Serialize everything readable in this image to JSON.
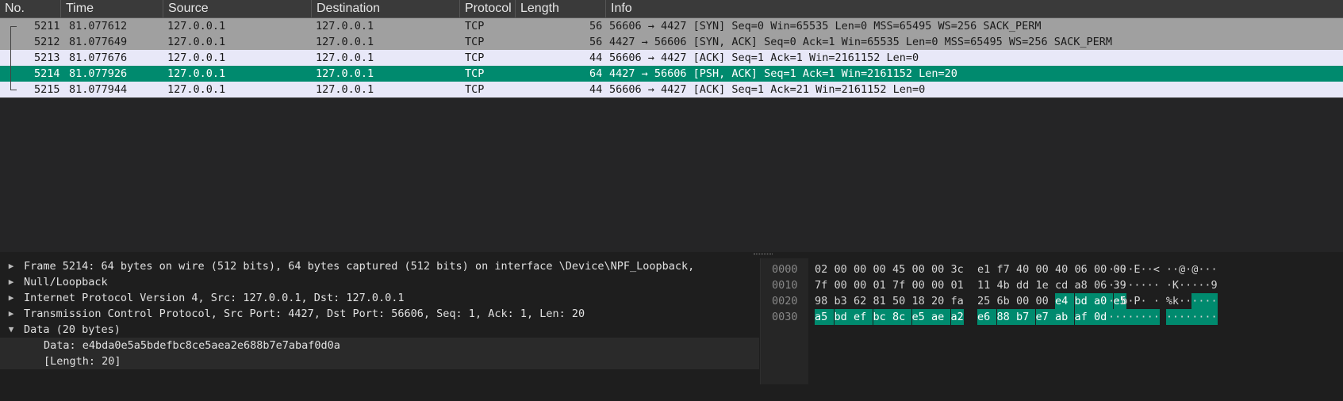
{
  "columns": [
    "No.",
    "Time",
    "Source",
    "Destination",
    "Protocol",
    "Length",
    "Info"
  ],
  "packets": [
    {
      "no": "5211",
      "time": "81.077612",
      "source": "127.0.0.1",
      "destination": "127.0.0.1",
      "protocol": "TCP",
      "length": "56",
      "info": "56606 → 4427 [SYN] Seq=0 Win=65535 Len=0 MSS=65495 WS=256 SACK_PERM"
    },
    {
      "no": "5212",
      "time": "81.077649",
      "source": "127.0.0.1",
      "destination": "127.0.0.1",
      "protocol": "TCP",
      "length": "56",
      "info": "4427 → 56606 [SYN, ACK] Seq=0 Ack=1 Win=65535 Len=0 MSS=65495 WS=256 SACK_PERM"
    },
    {
      "no": "5213",
      "time": "81.077676",
      "source": "127.0.0.1",
      "destination": "127.0.0.1",
      "protocol": "TCP",
      "length": "44",
      "info": "56606 → 4427 [ACK] Seq=1 Ack=1 Win=2161152 Len=0"
    },
    {
      "no": "5214",
      "time": "81.077926",
      "source": "127.0.0.1",
      "destination": "127.0.0.1",
      "protocol": "TCP",
      "length": "64",
      "info": "4427 → 56606 [PSH, ACK] Seq=1 Ack=1 Win=2161152 Len=20"
    },
    {
      "no": "5215",
      "time": "81.077944",
      "source": "127.0.0.1",
      "destination": "127.0.0.1",
      "protocol": "TCP",
      "length": "44",
      "info": "56606 → 4427 [ACK] Seq=1 Ack=21 Win=2161152 Len=0"
    }
  ],
  "details": [
    {
      "icon": "expand-right-icon",
      "text": "Frame 5214: 64 bytes on wire (512 bits), 64 bytes captured (512 bits) on interface \\Device\\NPF_Loopback,"
    },
    {
      "icon": "expand-right-icon",
      "text": "Null/Loopback"
    },
    {
      "icon": "expand-right-icon",
      "text": "Internet Protocol Version 4, Src: 127.0.0.1, Dst: 127.0.0.1"
    },
    {
      "icon": "expand-right-icon",
      "text": "Transmission Control Protocol, Src Port: 4427, Dst Port: 56606, Seq: 1, Ack: 1, Len: 20"
    },
    {
      "icon": "collapse-down-icon",
      "text": "Data (20 bytes)"
    },
    {
      "text": "Data: e4bda0e5a5bdefbc8ce5aea2e688b7e7abaf0d0a"
    },
    {
      "text": "[Length: 20]"
    }
  ],
  "hex_rows": [
    {
      "offset": "0000",
      "bytes": [
        "02",
        "00",
        "00",
        "00",
        "45",
        "00",
        "00",
        "3c",
        "e1",
        "f7",
        "40",
        "00",
        "40",
        "06",
        "00",
        "00"
      ],
      "ascii": "····E··<··@·@···"
    },
    {
      "offset": "0010",
      "bytes": [
        "7f",
        "00",
        "00",
        "01",
        "7f",
        "00",
        "00",
        "01",
        "11",
        "4b",
        "dd",
        "1e",
        "cd",
        "a8",
        "06",
        "39"
      ],
      "ascii": "·········K·····9"
    },
    {
      "offset": "0020",
      "bytes": [
        "98",
        "b3",
        "62",
        "81",
        "50",
        "18",
        "20",
        "fa",
        "25",
        "6b",
        "00",
        "00",
        "e4",
        "bd",
        "a0",
        "e5"
      ],
      "ascii": "··b·P· ·%k······"
    },
    {
      "offset": "0030",
      "bytes": [
        "a5",
        "bd",
        "ef",
        "bc",
        "8c",
        "e5",
        "ae",
        "a2",
        "e6",
        "88",
        "b7",
        "e7",
        "ab",
        "af",
        "0d",
        "0a"
      ],
      "ascii": "················"
    }
  ],
  "colors": {
    "selected": "#008a6e",
    "gray_row": "#a0a0a0",
    "light_row": "#e8e8f8"
  }
}
